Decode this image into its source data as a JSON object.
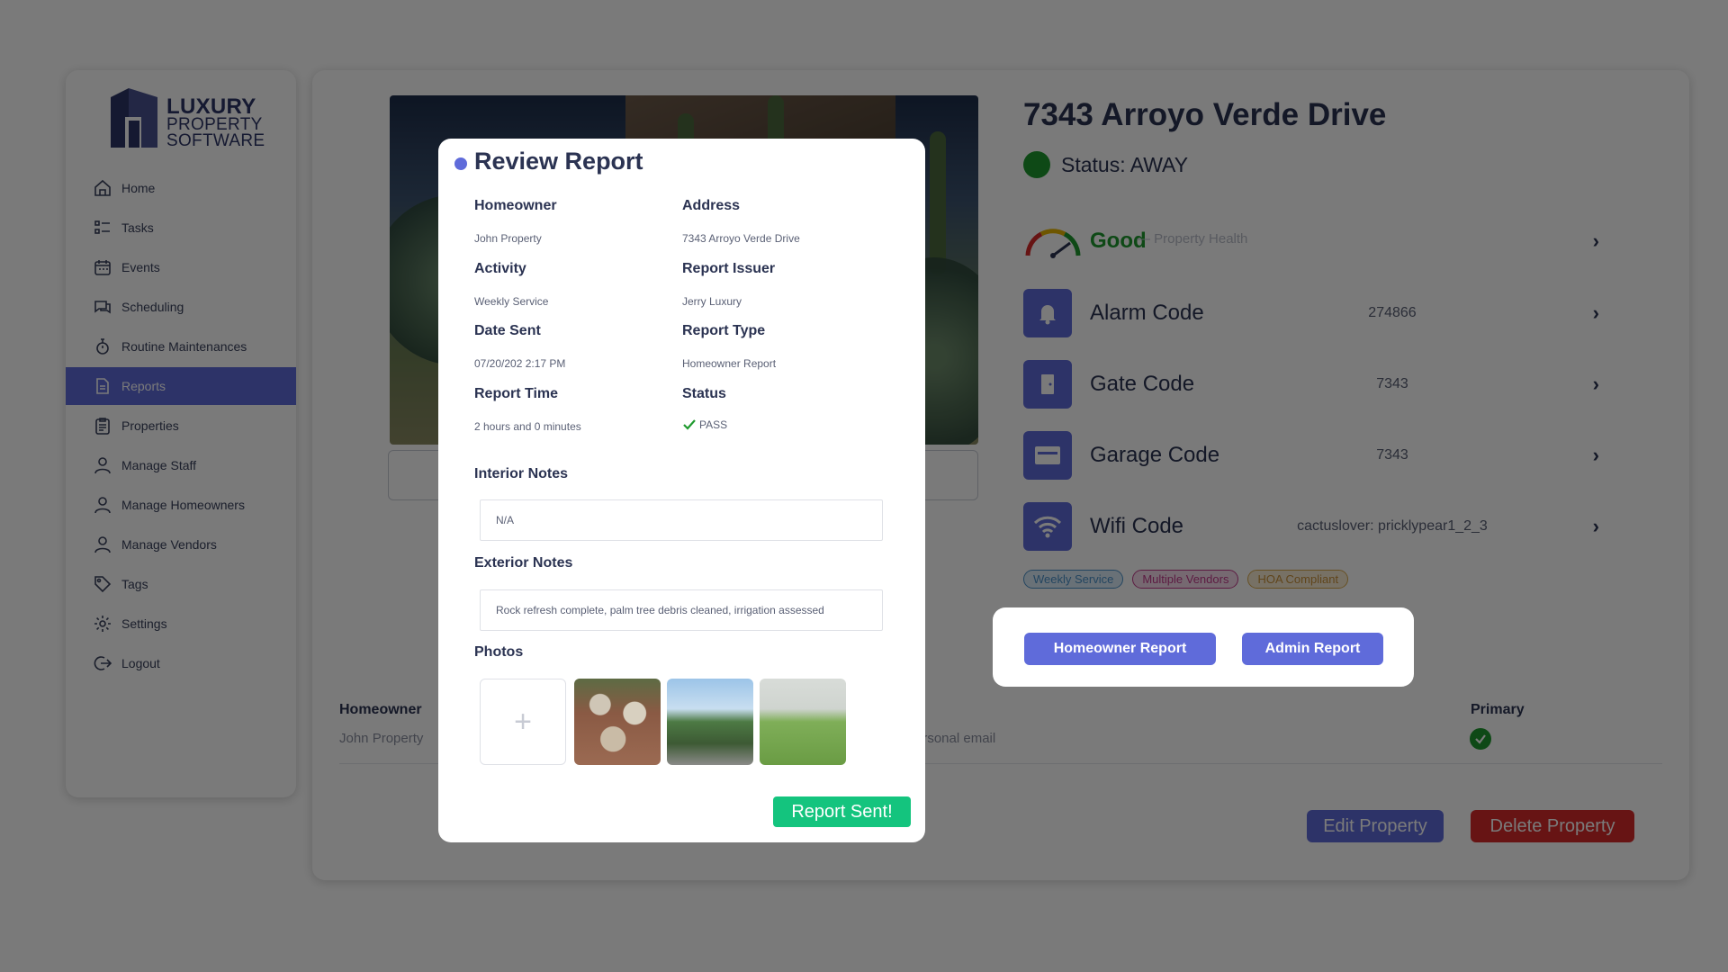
{
  "sidebar": {
    "logo": {
      "line1": "LUXURY",
      "line2": "PROPERTY",
      "line3": "SOFTWARE"
    },
    "items": [
      {
        "label": "Home",
        "icon": "home-icon"
      },
      {
        "label": "Tasks",
        "icon": "tasks-icon"
      },
      {
        "label": "Events",
        "icon": "calendar-icon"
      },
      {
        "label": "Scheduling",
        "icon": "chat-icon"
      },
      {
        "label": "Routine Maintenances",
        "icon": "stopwatch-icon"
      },
      {
        "label": "Reports",
        "icon": "document-icon"
      },
      {
        "label": "Properties",
        "icon": "clipboard-icon"
      },
      {
        "label": "Manage Staff",
        "icon": "user-icon"
      },
      {
        "label": "Manage Homeowners",
        "icon": "user-icon"
      },
      {
        "label": "Manage Vendors",
        "icon": "user-icon"
      },
      {
        "label": "Tags",
        "icon": "tag-icon"
      },
      {
        "label": "Settings",
        "icon": "gear-icon"
      },
      {
        "label": "Logout",
        "icon": "logout-icon"
      }
    ],
    "active": "Reports"
  },
  "property": {
    "title": "7343 Arroyo Verde Drive",
    "status": "Status: AWAY",
    "health": {
      "label": "Good",
      "sub": "— Property Health"
    },
    "codes": [
      {
        "label": "Alarm Code",
        "value": "274866",
        "icon": "bell-icon"
      },
      {
        "label": "Gate Code",
        "value": "7343",
        "icon": "door-icon"
      },
      {
        "label": "Garage Code",
        "value": "7343",
        "icon": "garage-icon"
      },
      {
        "label": "Wifi Code",
        "value": "cactuslover: pricklypear1_2_3",
        "icon": "wifi-icon"
      }
    ],
    "tags": [
      {
        "label": "Weekly Service",
        "color": "#4a90c8"
      },
      {
        "label": "Multiple Vendors",
        "color": "#c03a8a"
      },
      {
        "label": "HOA Compliant",
        "color": "#d8a84a"
      }
    ]
  },
  "report_buttons": {
    "homeowner": "Homeowner Report",
    "admin": "Admin Report"
  },
  "homeowners_table": {
    "homeowner_header": "Homeowner",
    "homeowner_value": "John Property",
    "email_value": "ersonal email",
    "primary_header": "Primary"
  },
  "actions": {
    "edit": "Edit Property",
    "delete": "Delete Property"
  },
  "modal": {
    "title": "Review Report",
    "fields": {
      "homeowner_label": "Homeowner",
      "homeowner_value": "John Property",
      "address_label": "Address",
      "address_value": "7343 Arroyo Verde Drive",
      "activity_label": "Activity",
      "activity_value": "Weekly Service",
      "issuer_label": "Report Issuer",
      "issuer_value": "Jerry Luxury",
      "date_label": "Date Sent",
      "date_value": "07/20/202 2:17 PM",
      "type_label": "Report Type",
      "type_value": "Homeowner Report",
      "time_label": "Report Time",
      "time_value": "2 hours and 0 minutes",
      "status_label": "Status",
      "status_value": "PASS"
    },
    "interior_label": "Interior Notes",
    "interior_value": "N/A",
    "exterior_label": "Exterior Notes",
    "exterior_value": "Rock refresh complete, palm tree debris cleaned, irrigation assessed",
    "photos_label": "Photos",
    "add_symbol": "+",
    "sent_button": "Report Sent!"
  },
  "colors": {
    "accent": "#5f6bda",
    "success": "#1f9a2e",
    "danger": "#d82a2a",
    "sent": "#14c47e"
  }
}
